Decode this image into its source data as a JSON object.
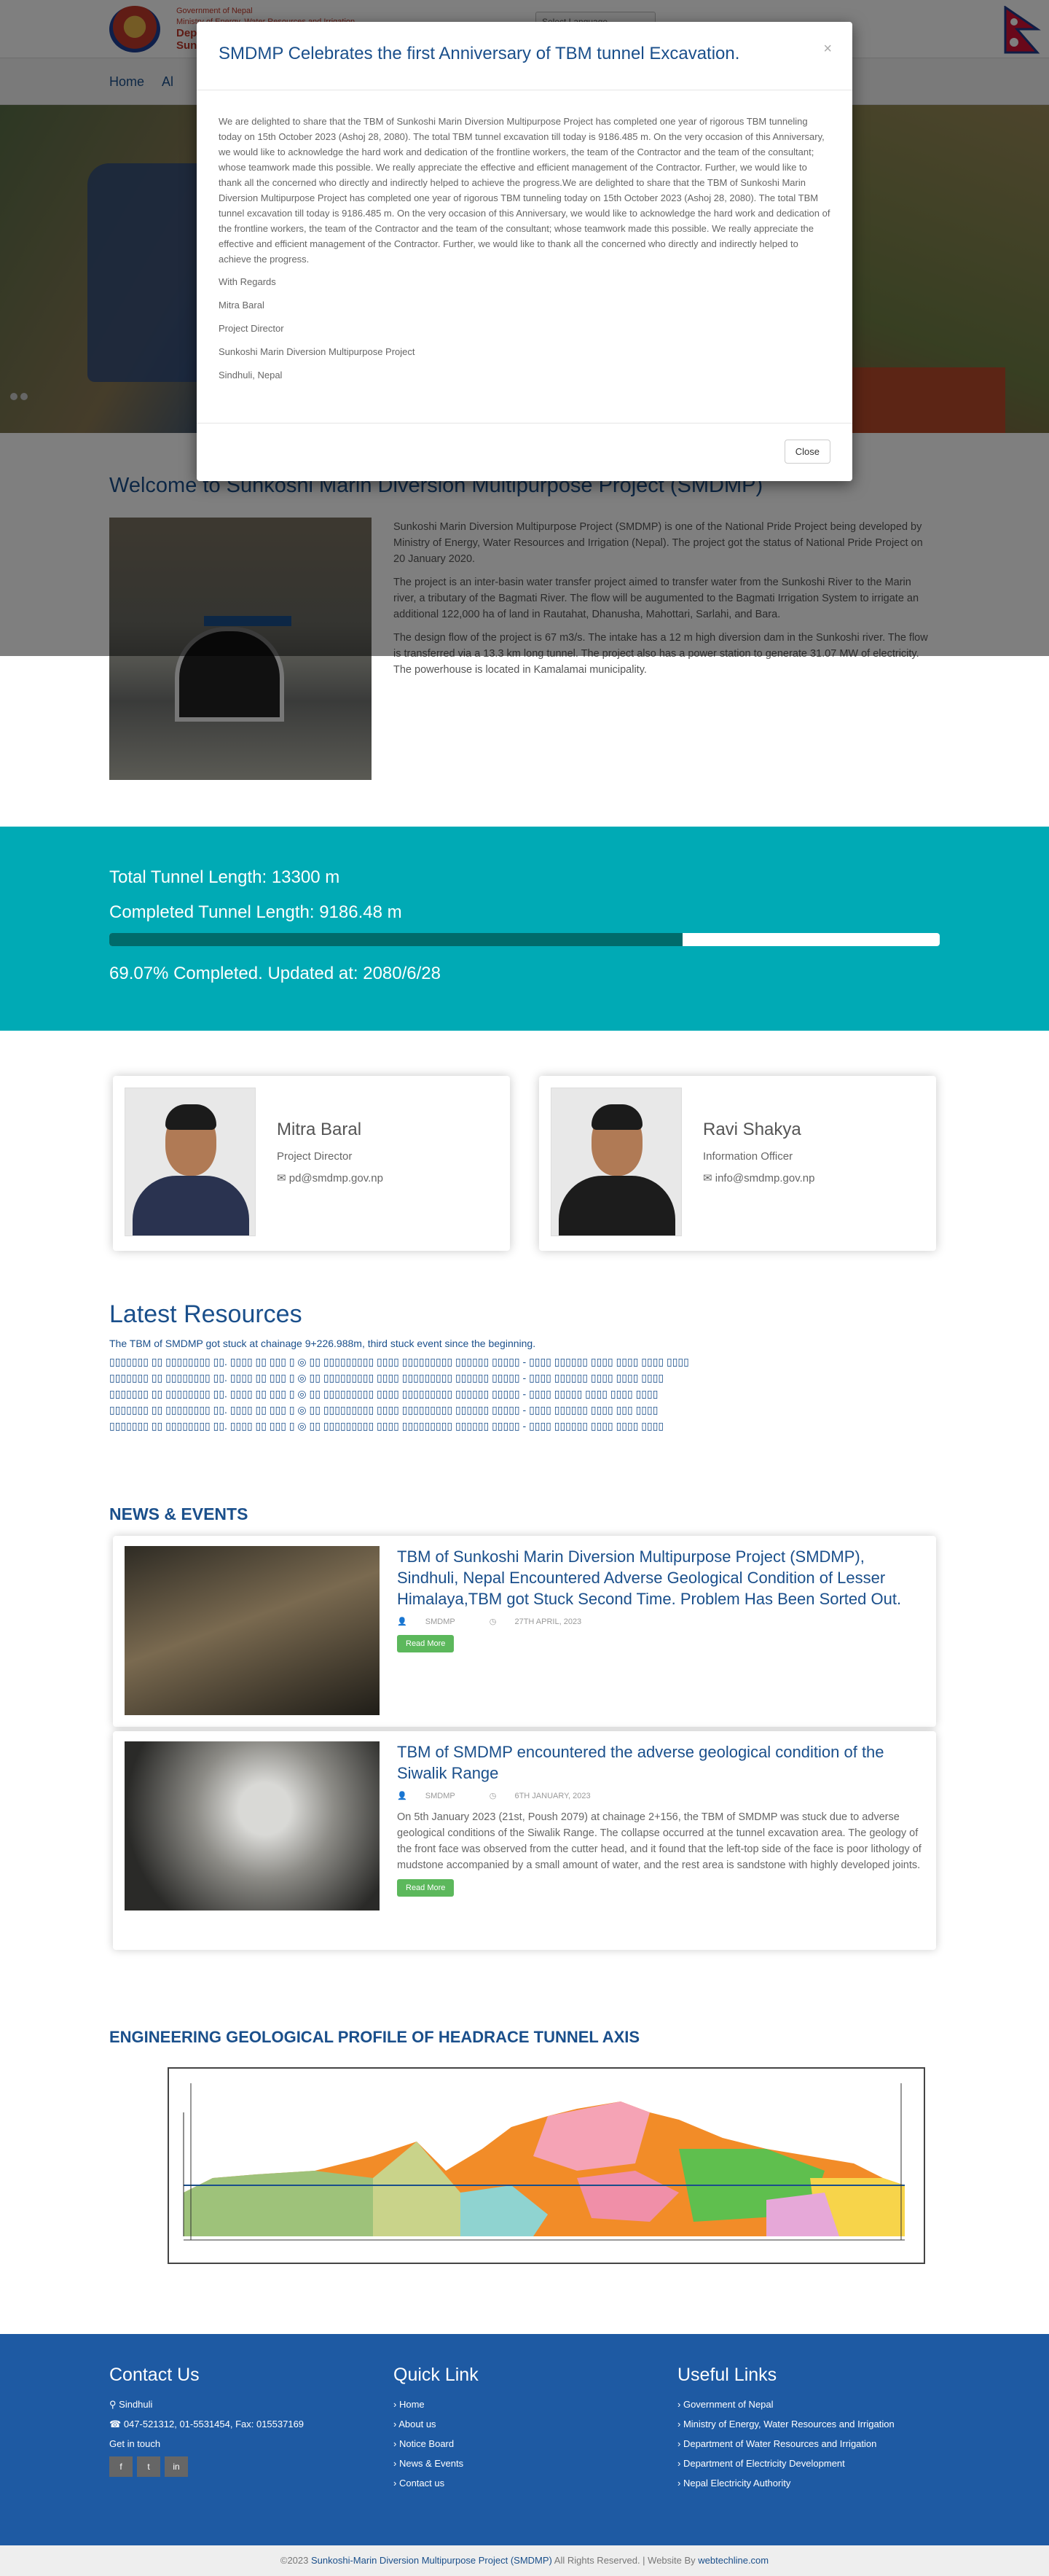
{
  "header": {
    "gov_line1": "Government of Nepal",
    "gov_line2": "Ministry of Energy, Water Resources and Irrigation",
    "gov_line3": "Depa",
    "gov_line4": "Sun",
    "language_select": "Select Language",
    "nav": [
      "Home",
      "Al"
    ]
  },
  "modal": {
    "title": "SMDMP Celebrates the first Anniversary of TBM tunnel Excavation.",
    "close_x": "×",
    "body": "We are delighted to share that the TBM of Sunkoshi Marin Diversion Multipurpose Project has completed one year of rigorous TBM tunneling today on 15th October 2023 (Ashoj 28, 2080). The total TBM tunnel excavation till today is 9186.485 m. On the very occasion of this Anniversary, we would like to acknowledge the hard work and dedication of the frontline workers, the team of the Contractor and the team of the consultant; whose teamwork made this possible. We really appreciate the effective and efficient management of the Contractor. Further, we would like to thank all the concerned who directly and indirectly helped to achieve the progress.We are delighted to share that the TBM of Sunkoshi Marin Diversion Multipurpose Project has completed one year of rigorous TBM tunneling today on 15th October 2023 (Ashoj 28, 2080). The total TBM tunnel excavation till today is 9186.485 m. On the very occasion of this Anniversary, we would like to acknowledge the hard work and dedication of the frontline workers, the team of the Contractor and the team of the consultant; whose teamwork made this possible. We really appreciate the effective and efficient management of the Contractor. Further, we would like to thank all the concerned who directly and indirectly helped to achieve the progress.",
    "regards": "With Regards",
    "name": "Mitra Baral",
    "position": "Project Director",
    "org": "Sunkoshi Marin Diversion Multipurpose Project",
    "place": "Sindhuli, Nepal",
    "close_button": "Close"
  },
  "welcome": {
    "title": "Welcome to Sunkoshi Marin Diversion Multipurpose Project (SMDMP)",
    "p1": "Sunkoshi Marin Diversion Multipurpose Project (SMDMP) is one of the National Pride Project being developed by Ministry of Energy, Water Resources and Irrigation (Nepal). The project got the status of National Pride Project on 20 January 2020.",
    "p2": "The project is an inter-basin water transfer project aimed to transfer water from the Sunkoshi River to the Marin river, a tributary of the Bagmati River. The flow will be augumented to the Bagmati Irrigation System to irrigate an additional 122,000 ha of land in Rautahat, Dhanusha, Mahottari, Sarlahi, and Bara.",
    "p3": "The design flow of the project is 67 m3/s. The intake has a 12 m high diversion dam in the Sunkoshi river. The flow is transferred via a 13.3 km long tunnel. The project also has a power station to generate 31.07 MW of electricity. The powerhouse is located in Kamalamai municipality."
  },
  "progress": {
    "total": "Total Tunnel Length: 13300 m",
    "completed": "Completed Tunnel Length: 9186.48 m",
    "status": "69.07% Completed. Updated at: 2080/6/28",
    "percent": 69.07
  },
  "people": [
    {
      "name": "Mitra Baral",
      "role": "Project Director",
      "email": "pd@smdmp.gov.np"
    },
    {
      "name": "Ravi Shakya",
      "role": "Information Officer",
      "email": "info@smdmp.gov.np"
    }
  ],
  "resources": {
    "title": "Latest Resources",
    "first": "The TBM of SMDMP got stuck at chainage 9+226.988m, third stuck event since the beginning.",
    "rows": [
      "▯▯▯▯▯▯▯ ▯▯ ▯▯▯▯▯▯▯▯ ▯▯. ▯▯▯▯ ▯▯ ▯▯▯ ▯ ◎ ▯▯ ▯▯▯▯▯▯▯▯▯ ▯▯▯▯ ▯▯▯▯▯▯▯▯▯ ▯▯▯▯▯▯ ▯▯▯▯▯ - ▯▯▯▯ ▯▯▯▯▯▯ ▯▯▯▯ ▯▯▯▯ ▯▯▯▯ ▯▯▯▯",
      "▯▯▯▯▯▯▯ ▯▯ ▯▯▯▯▯▯▯▯ ▯▯. ▯▯▯▯ ▯▯ ▯▯▯ ▯ ◎ ▯▯ ▯▯▯▯▯▯▯▯▯ ▯▯▯▯ ▯▯▯▯▯▯▯▯▯ ▯▯▯▯▯▯ ▯▯▯▯▯ - ▯▯▯▯ ▯▯▯▯▯▯ ▯▯▯▯ ▯▯▯▯ ▯▯▯▯",
      "▯▯▯▯▯▯▯ ▯▯ ▯▯▯▯▯▯▯▯ ▯▯. ▯▯▯▯ ▯▯ ▯▯▯ ▯ ◎ ▯▯ ▯▯▯▯▯▯▯▯▯ ▯▯▯▯ ▯▯▯▯▯▯▯▯▯ ▯▯▯▯▯▯ ▯▯▯▯▯ - ▯▯▯▯ ▯▯▯▯▯ ▯▯▯▯ ▯▯▯▯ ▯▯▯▯",
      "▯▯▯▯▯▯▯ ▯▯ ▯▯▯▯▯▯▯▯ ▯▯. ▯▯▯▯ ▯▯ ▯▯▯ ▯ ◎ ▯▯ ▯▯▯▯▯▯▯▯▯ ▯▯▯▯ ▯▯▯▯▯▯▯▯▯ ▯▯▯▯▯▯ ▯▯▯▯▯ - ▯▯▯▯ ▯▯▯▯▯▯ ▯▯▯▯ ▯▯▯ ▯▯▯▯",
      "▯▯▯▯▯▯▯ ▯▯ ▯▯▯▯▯▯▯▯ ▯▯. ▯▯▯▯ ▯▯ ▯▯▯ ▯ ◎ ▯▯ ▯▯▯▯▯▯▯▯▯ ▯▯▯▯ ▯▯▯▯▯▯▯▯▯ ▯▯▯▯▯▯ ▯▯▯▯▯ - ▯▯▯▯ ▯▯▯▯▯▯ ▯▯▯▯ ▯▯▯▯ ▯▯▯▯"
    ]
  },
  "news": {
    "title": "NEWS & EVENTS",
    "items": [
      {
        "title": "TBM of Sunkoshi Marin Diversion Multipurpose Project (SMDMP), Sindhuli, Nepal Encountered Adverse Geological Condition of Lesser Himalaya,TBM got Stuck Second Time. Problem Has Been Sorted Out.",
        "author": "SMDMP",
        "date": "27TH APRIL, 2023",
        "desc": "",
        "button": "Read More"
      },
      {
        "title": "TBM of SMDMP encountered the adverse geological condition of the Siwalik Range",
        "author": "SMDMP",
        "date": "6TH JANUARY, 2023",
        "desc": "On 5th January 2023 (21st, Poush 2079) at chainage 2+156, the TBM of SMDMP was stuck due to adverse geological conditions of the Siwalik Range. The collapse occurred at the tunnel excavation area. The geology of the front face was observed from the cutter head, and it found that the left-top side of the face is poor lithology of mudstone accompanied by a small amount of water, and the rest area is sandstone with highly developed joints.",
        "button": "Read More"
      }
    ]
  },
  "profile": {
    "title": "ENGINEERING GEOLOGICAL PROFILE OF HEADRACE TUNNEL AXIS"
  },
  "footer": {
    "contact": {
      "title": "Contact Us",
      "location": "Sindhuli",
      "phone": "047-521312, 01-5531454, Fax: 015537169",
      "get_in_touch": "Get in touch",
      "social": [
        "f",
        "t",
        "in"
      ]
    },
    "quick": {
      "title": "Quick Link",
      "items": [
        "Home",
        "About us",
        "Notice Board",
        "News & Events",
        "Contact us"
      ]
    },
    "useful": {
      "title": "Useful Links",
      "items": [
        "Government of Nepal",
        "Ministry of Energy, Water Resources and Irrigation",
        "Department of Water Resources and Irrigation",
        "Department of Electricity Development",
        "Nepal Electricity Authority"
      ]
    },
    "copyright_pre": "©2023 ",
    "copyright_org": "Sunkoshi-Marin Diversion Multipurpose Project (SMDMP)",
    "copyright_mid": " All Rights Reserved. | Website By ",
    "copyright_by": "webtechline.com"
  },
  "colors": {
    "brand_blue": "#1a4f8b",
    "teal": "#00aab5",
    "footer_blue": "#1e5aa3",
    "green_button": "#5cb85c"
  }
}
